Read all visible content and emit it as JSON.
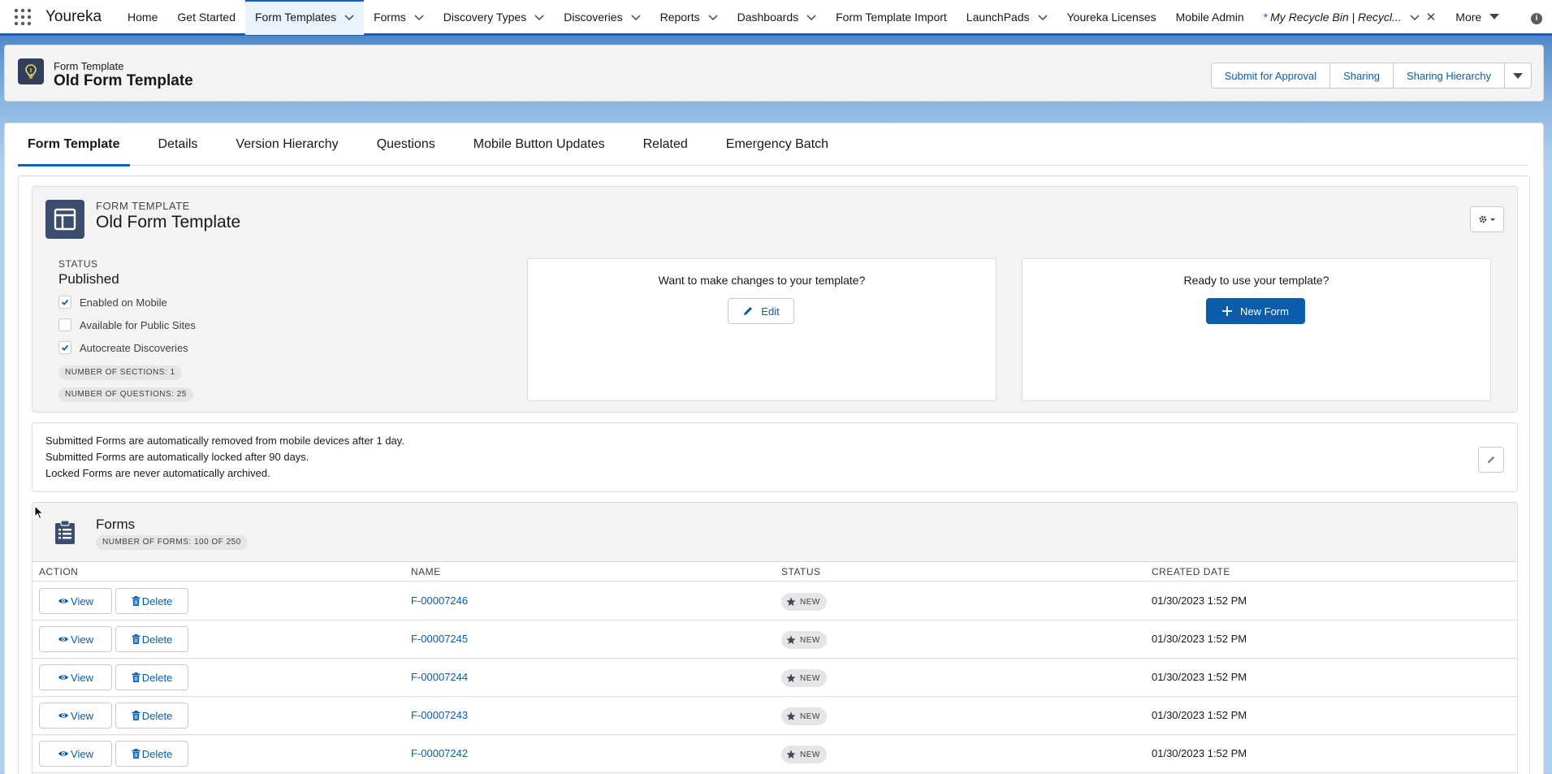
{
  "app": {
    "name": "Youreka"
  },
  "nav": {
    "items": [
      {
        "label": "Home",
        "has_menu": false,
        "active": false
      },
      {
        "label": "Get Started",
        "has_menu": false,
        "active": false
      },
      {
        "label": "Form Templates",
        "has_menu": true,
        "active": true
      },
      {
        "label": "Forms",
        "has_menu": true,
        "active": false
      },
      {
        "label": "Discovery Types",
        "has_menu": true,
        "active": false
      },
      {
        "label": "Discoveries",
        "has_menu": true,
        "active": false
      },
      {
        "label": "Reports",
        "has_menu": true,
        "active": false
      },
      {
        "label": "Dashboards",
        "has_menu": true,
        "active": false
      },
      {
        "label": "Form Template Import",
        "has_menu": false,
        "active": false
      },
      {
        "label": "LaunchPads",
        "has_menu": true,
        "active": false
      },
      {
        "label": "Youreka Licenses",
        "has_menu": false,
        "active": false
      },
      {
        "label": "Mobile Admin",
        "has_menu": false,
        "active": false
      }
    ],
    "recycle_tab": {
      "star": "*",
      "label": "My Recycle Bin | Recycl..."
    },
    "more_label": "More"
  },
  "record": {
    "type": "Form Template",
    "title": "Old Form Template",
    "actions": [
      "Submit for Approval",
      "Sharing",
      "Sharing Hierarchy"
    ]
  },
  "tabs": [
    "Form Template",
    "Details",
    "Version Hierarchy",
    "Questions",
    "Mobile Button Updates",
    "Related",
    "Emergency Batch"
  ],
  "summary": {
    "eyebrow": "FORM TEMPLATE",
    "title": "Old Form Template",
    "status_label": "STATUS",
    "status_value": "Published",
    "checks": [
      {
        "label": "Enabled on Mobile",
        "checked": true
      },
      {
        "label": "Available for Public Sites",
        "checked": false
      },
      {
        "label": "Autocreate Discoveries",
        "checked": true
      }
    ],
    "sections_pill": "NUMBER OF SECTIONS: 1",
    "questions_pill": "NUMBER OF QUESTIONS: 25",
    "edit_box": {
      "prompt": "Want to make changes to your template?",
      "button": "Edit"
    },
    "use_box": {
      "prompt": "Ready to use your template?",
      "button": "New Form"
    }
  },
  "retention": {
    "lines": [
      "Submitted Forms are automatically removed from mobile devices after 1 day.",
      "Submitted Forms are automatically locked after 90 days.",
      "Locked Forms are never automatically archived."
    ]
  },
  "forms": {
    "title": "Forms",
    "count": "NUMBER OF FORMS: 100 OF 250",
    "columns": [
      "ACTION",
      "NAME",
      "STATUS",
      "CREATED DATE"
    ],
    "view_label": "View",
    "delete_label": "Delete",
    "rows": [
      {
        "name": "F-00007246",
        "status": "NEW",
        "created": "01/30/2023 1:52 PM"
      },
      {
        "name": "F-00007245",
        "status": "NEW",
        "created": "01/30/2023 1:52 PM"
      },
      {
        "name": "F-00007244",
        "status": "NEW",
        "created": "01/30/2023 1:52 PM"
      },
      {
        "name": "F-00007243",
        "status": "NEW",
        "created": "01/30/2023 1:52 PM"
      },
      {
        "name": "F-00007242",
        "status": "NEW",
        "created": "01/30/2023 1:52 PM"
      }
    ]
  },
  "colors": {
    "brand": "#0b5cab",
    "nav_accent": "#1b5fb5",
    "icon_dark": "#2f3f5c"
  }
}
